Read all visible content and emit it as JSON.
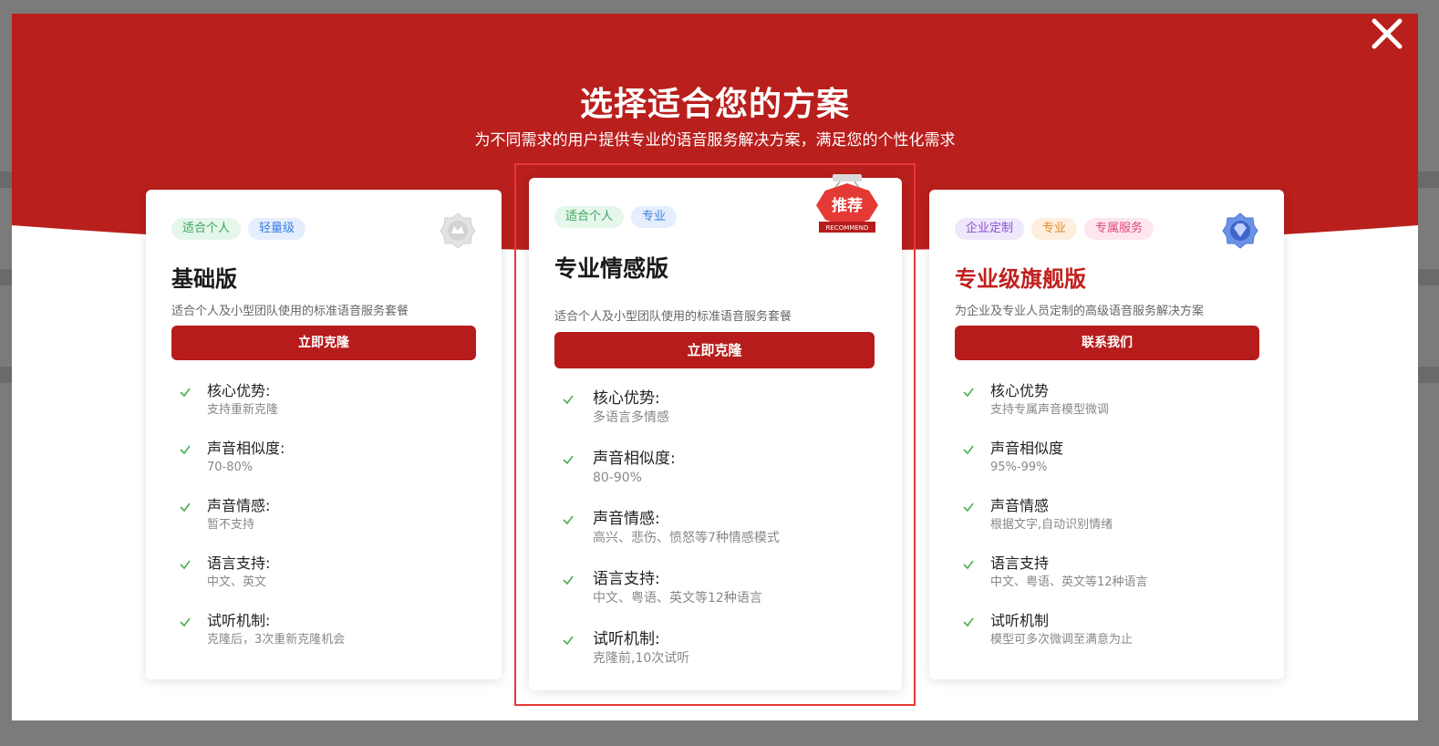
{
  "modal": {
    "title": "选择适合您的方案",
    "subtitle": "为不同需求的用户提供专业的语音服务解决方案，满足您的个性化需求",
    "close_icon": "close-icon",
    "header_color": "#b91f1c"
  },
  "plans": [
    {
      "tags": [
        "适合个人",
        "轻量级"
      ],
      "name": "基础版",
      "description": "适合个人及小型团队使用的标准语音服务套餐",
      "cta": "立即克隆",
      "badge_icon": "silver-medal-icon",
      "features": [
        {
          "label": "核心优势:",
          "value": "支持重新克隆"
        },
        {
          "label": "声音相似度:",
          "value": "70-80%"
        },
        {
          "label": "声音情感:",
          "value": "暂不支持"
        },
        {
          "label": "语言支持:",
          "value": "中文、英文"
        },
        {
          "label": "试听机制:",
          "value": "克隆后，3次重新克隆机会"
        }
      ]
    },
    {
      "tags": [
        "适合个人",
        "专业"
      ],
      "name": "专业情感版",
      "description": "适合个人及小型团队使用的标准语音服务套餐",
      "cta": "立即克隆",
      "recommend_label": "推荐",
      "recommend_sub": "RECOMMEND",
      "features": [
        {
          "label": "核心优势:",
          "value": "多语言多情感"
        },
        {
          "label": "声音相似度:",
          "value": "80-90%"
        },
        {
          "label": "声音情感:",
          "value": "高兴、悲伤、愤怒等7种情感模式"
        },
        {
          "label": "语言支持:",
          "value": "中文、粤语、英文等12种语言"
        },
        {
          "label": "试听机制:",
          "value": "克隆前,10次试听"
        }
      ]
    },
    {
      "tags": [
        "企业定制",
        "专业",
        "专属服务"
      ],
      "name": "专业级旗舰版",
      "description": "为企业及专业人员定制的高级语音服务解决方案",
      "cta": "联系我们",
      "badge_icon": "diamond-medal-icon",
      "features": [
        {
          "label": "核心优势",
          "value": "支持专属声音模型微调"
        },
        {
          "label": "声音相似度",
          "value": "95%-99%"
        },
        {
          "label": "声音情感",
          "value": "根据文字,自动识别情绪"
        },
        {
          "label": "语言支持",
          "value": "中文、粤语、英文等12种语言"
        },
        {
          "label": "试听机制",
          "value": "模型可多次微调至满意为止"
        }
      ]
    }
  ]
}
